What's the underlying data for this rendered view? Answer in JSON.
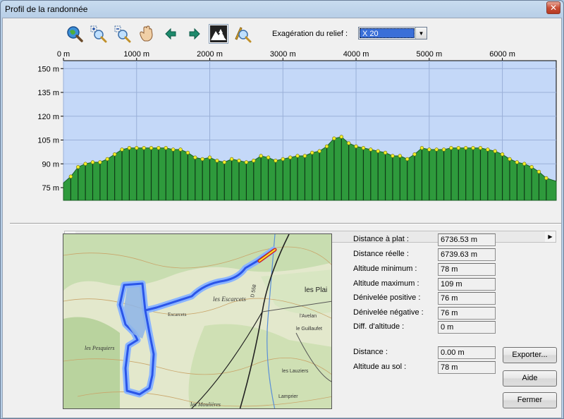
{
  "window": {
    "title": "Profil de la randonnée",
    "close": "✕"
  },
  "toolbar": {
    "buttons": [
      {
        "name": "zoom-fit",
        "icon": "globe-magnifier-icon"
      },
      {
        "name": "zoom-in",
        "icon": "zoom-in-icon"
      },
      {
        "name": "zoom-out",
        "icon": "zoom-out-icon"
      },
      {
        "name": "pan",
        "icon": "hand-icon"
      },
      {
        "name": "back",
        "icon": "arrow-left-icon"
      },
      {
        "name": "forward",
        "icon": "arrow-right-icon"
      },
      {
        "name": "relief-view",
        "icon": "mountain-trees-icon",
        "active": true
      },
      {
        "name": "measure",
        "icon": "measure-magnifier-icon"
      }
    ],
    "relief_label": "Exagération du relief :",
    "relief_value": "X 20"
  },
  "chart_data": {
    "type": "area",
    "x_ticks": [
      "0 m",
      "1000 m",
      "2000 m",
      "3000 m",
      "4000 m",
      "5000 m",
      "6000 m"
    ],
    "y_ticks": [
      "150 m",
      "135 m",
      "120 m",
      "105 m",
      "90 m",
      "75 m"
    ],
    "xlim": [
      0,
      6736.53
    ],
    "ylim": [
      67,
      155
    ],
    "grid": true,
    "x": [
      0,
      100,
      200,
      300,
      400,
      500,
      600,
      700,
      800,
      900,
      1000,
      1100,
      1200,
      1300,
      1400,
      1500,
      1600,
      1700,
      1800,
      1900,
      2000,
      2100,
      2200,
      2300,
      2400,
      2500,
      2600,
      2700,
      2800,
      2900,
      3000,
      3100,
      3200,
      3300,
      3400,
      3500,
      3600,
      3700,
      3800,
      3900,
      4000,
      4100,
      4200,
      4300,
      4400,
      4500,
      4600,
      4700,
      4800,
      4900,
      5000,
      5100,
      5200,
      5300,
      5400,
      5500,
      5600,
      5700,
      5800,
      5900,
      6000,
      6100,
      6200,
      6300,
      6400,
      6500,
      6600,
      6736.53
    ],
    "y": [
      78,
      82,
      88,
      90,
      91,
      91,
      93,
      96,
      99,
      100,
      100,
      100,
      100,
      100,
      100,
      99,
      99,
      97,
      94,
      93,
      94,
      92,
      91,
      93,
      92,
      91,
      92,
      95,
      94,
      92,
      93,
      94,
      95,
      95,
      97,
      98,
      101,
      106,
      107,
      103,
      101,
      100,
      99,
      98,
      97,
      95,
      95,
      93,
      96,
      100,
      99,
      99,
      99,
      100,
      100,
      100,
      100,
      100,
      99,
      98,
      96,
      93,
      91,
      90,
      88,
      85,
      81,
      79
    ]
  },
  "stats": [
    {
      "label": "Distance à plat :",
      "value": "6736.53 m"
    },
    {
      "label": "Distance réelle :",
      "value": "6739.63 m"
    },
    {
      "label": "Altitude minimum :",
      "value": "78 m"
    },
    {
      "label": "Altitude maximum :",
      "value": "109 m"
    },
    {
      "label": "Dénivelée positive :",
      "value": "76 m"
    },
    {
      "label": "Dénivelée négative :",
      "value": "76 m"
    },
    {
      "label": "Diff. d'altitude :",
      "value": "0 m"
    }
  ],
  "cursor": [
    {
      "label": "Distance :",
      "value": "0.00 m"
    },
    {
      "label": "Altitude au sol :",
      "value": "78 m"
    }
  ],
  "buttons": {
    "export": "Exporter...",
    "help": "Aide",
    "close": "Fermer"
  },
  "map": {
    "labels": [
      "les Escarcets",
      "les Plai",
      "les Pesquiers",
      "les Moulières",
      "le Guillaufet",
      "Lamprier",
      "l'Avelan",
      "les Lauziers",
      "Escarcets",
      "D 558"
    ]
  },
  "colors": {
    "sky": "#c4d8f8",
    "terrain": "#2e9a3c",
    "terrain_dark": "#1a5f24",
    "marker": "#f2ee2a",
    "track": "#2a55e8",
    "track_glow": "#8ab4ff",
    "track_end": "#d8281e"
  }
}
